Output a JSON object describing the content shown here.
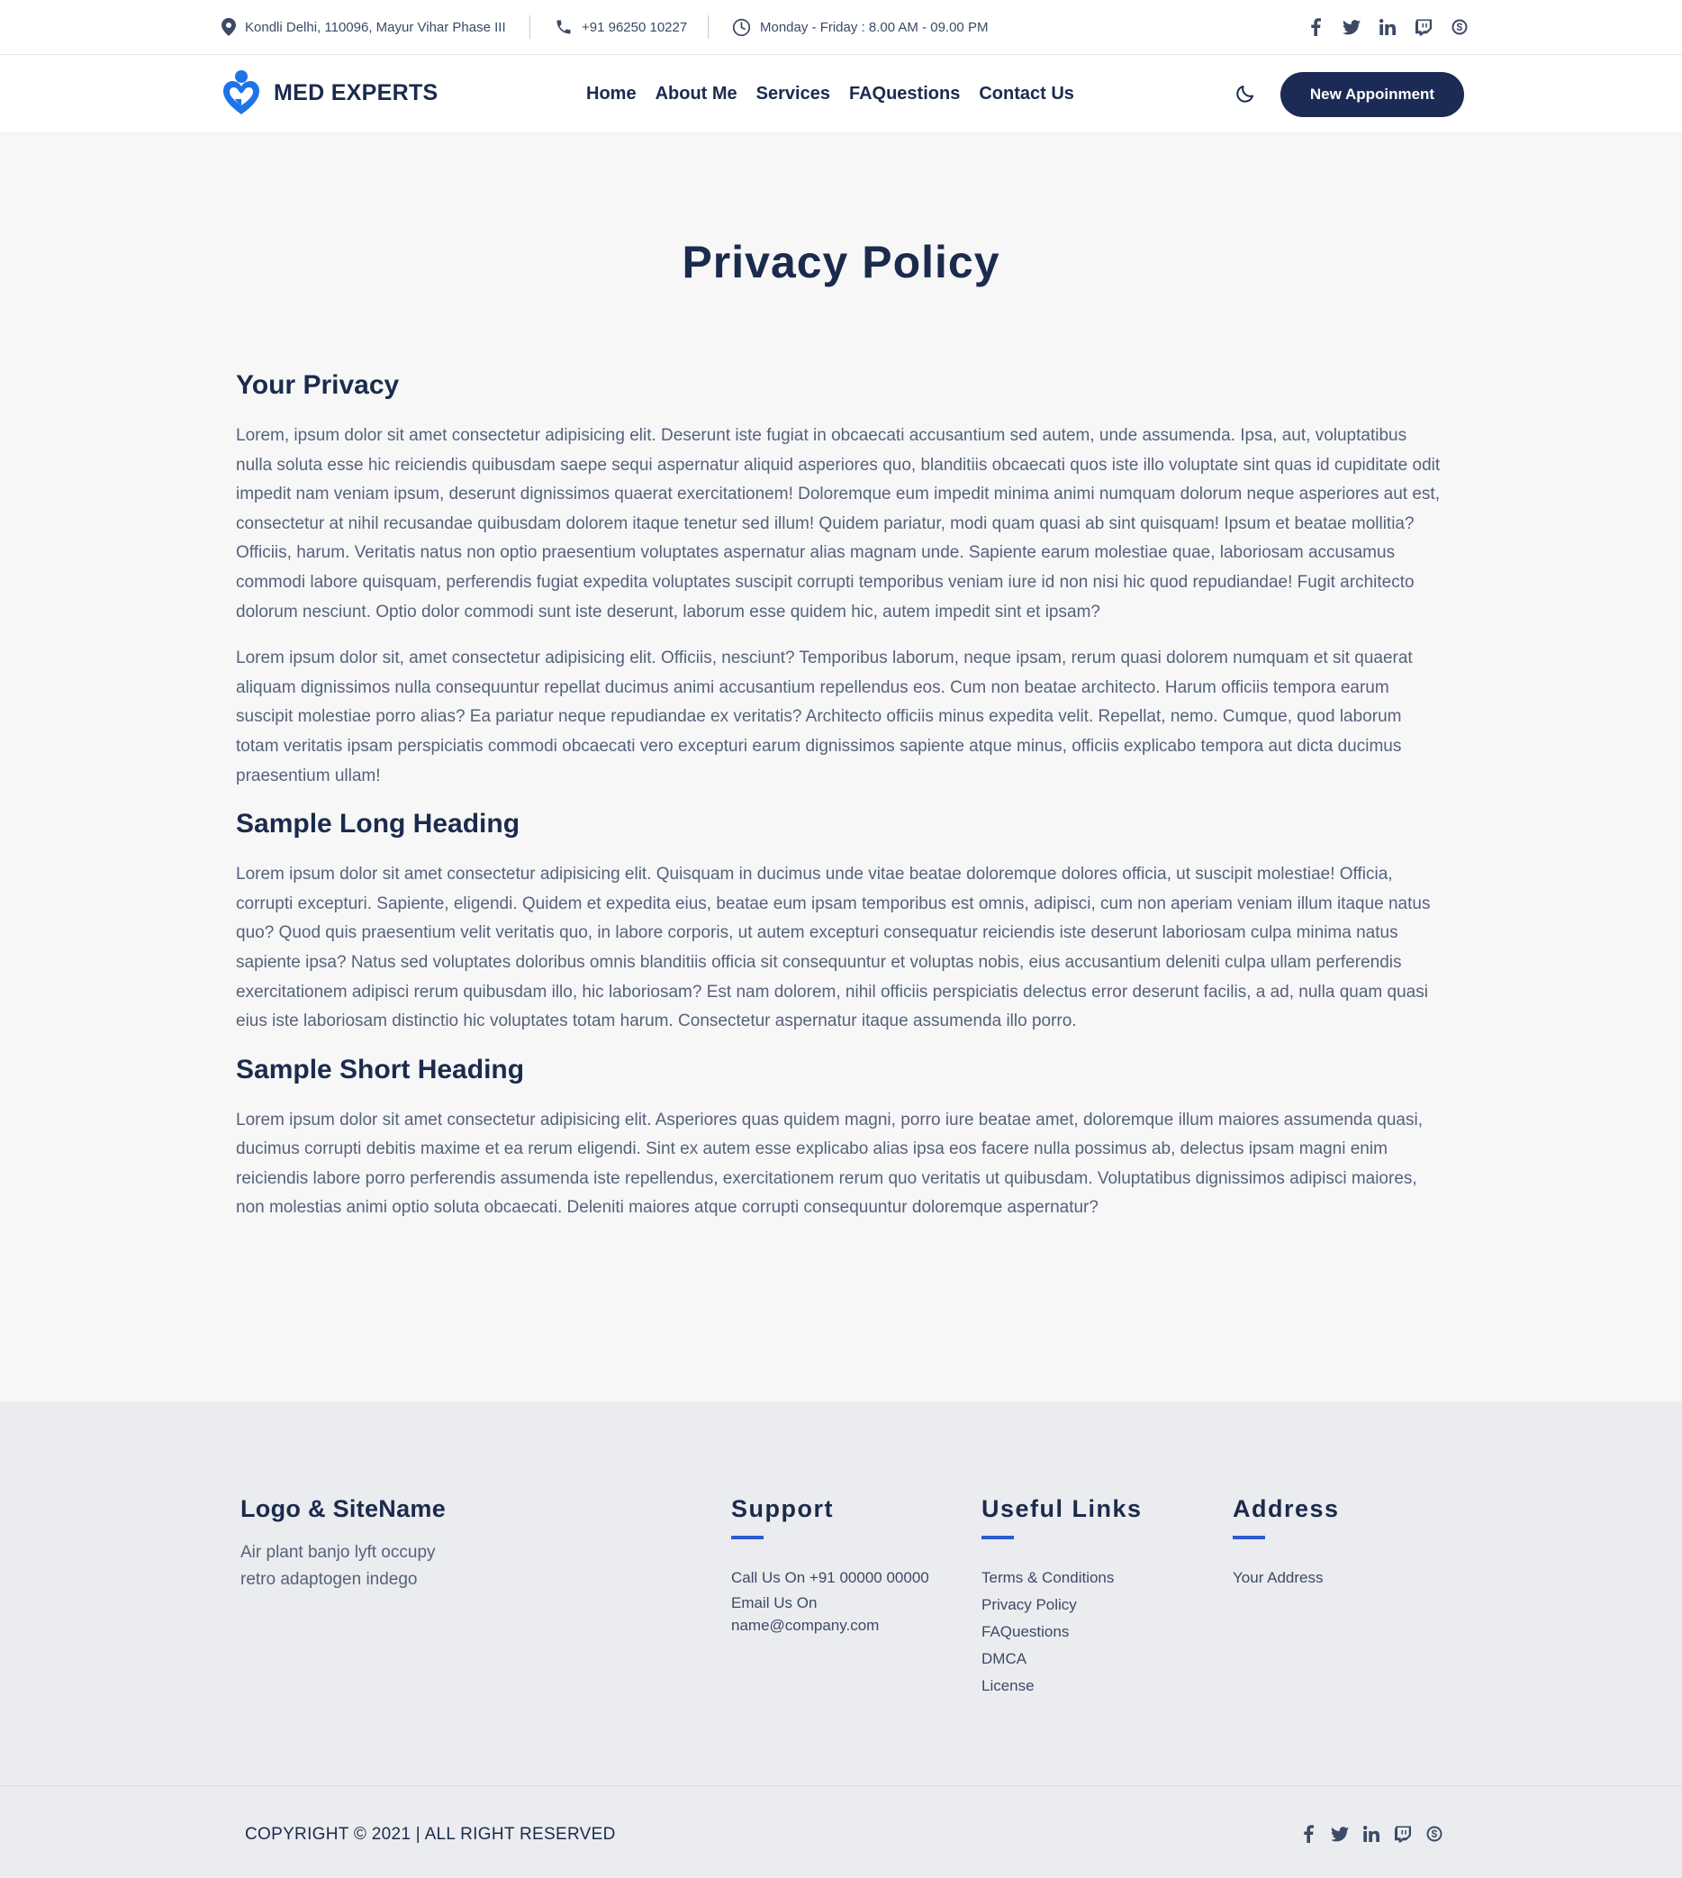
{
  "topbar": {
    "address": "Kondli Delhi, 110096, Mayur Vihar Phase III",
    "phone": "+91 96250 10227",
    "hours": "Monday - Friday : 8.00 AM - 09.00 PM",
    "socials": [
      "facebook-icon",
      "twitter-icon",
      "linkedin-icon",
      "twitch-icon",
      "skype-icon"
    ]
  },
  "nav": {
    "brand": "MED EXPERTS",
    "links": [
      "Home",
      "About Me",
      "Services",
      "FAQuestions",
      "Contact Us"
    ],
    "cta": "New Appoinment"
  },
  "colors": {
    "primary": "#1b2b55",
    "accent": "#2d5bd0",
    "logo": "#1f73e8"
  },
  "main": {
    "title": "Privacy Policy",
    "sections": [
      {
        "heading": "Your Privacy",
        "paragraphs": [
          "Lorem, ipsum dolor sit amet consectetur adipisicing elit. Deserunt iste fugiat in obcaecati accusantium sed autem, unde assumenda. Ipsa, aut, voluptatibus nulla soluta esse hic reiciendis quibusdam saepe sequi aspernatur aliquid asperiores quo, blanditiis obcaecati quos iste illo voluptate sint quas id cupiditate odit impedit nam veniam ipsum, deserunt dignissimos quaerat exercitationem! Doloremque eum impedit minima animi numquam dolorum neque asperiores aut est, consectetur at nihil recusandae quibusdam dolorem itaque tenetur sed illum! Quidem pariatur, modi quam quasi ab sint quisquam! Ipsum et beatae mollitia? Officiis, harum. Veritatis natus non optio praesentium voluptates aspernatur alias magnam unde. Sapiente earum molestiae quae, laboriosam accusamus commodi labore quisquam, perferendis fugiat expedita voluptates suscipit corrupti temporibus veniam iure id non nisi hic quod repudiandae! Fugit architecto dolorum nesciunt. Optio dolor commodi sunt iste deserunt, laborum esse quidem hic, autem impedit sint et ipsam?",
          "Lorem ipsum dolor sit, amet consectetur adipisicing elit. Officiis, nesciunt? Temporibus laborum, neque ipsam, rerum quasi dolorem numquam et sit quaerat aliquam dignissimos nulla consequuntur repellat ducimus animi accusantium repellendus eos. Cum non beatae architecto. Harum officiis tempora earum suscipit molestiae porro alias? Ea pariatur neque repudiandae ex veritatis? Architecto officiis minus expedita velit. Repellat, nemo. Cumque, quod laborum totam veritatis ipsam perspiciatis commodi obcaecati vero excepturi earum dignissimos sapiente atque minus, officiis explicabo tempora aut dicta ducimus praesentium ullam!"
        ]
      },
      {
        "heading": "Sample Long Heading",
        "paragraphs": [
          "Lorem ipsum dolor sit amet consectetur adipisicing elit. Quisquam in ducimus unde vitae beatae doloremque dolores officia, ut suscipit molestiae! Officia, corrupti excepturi. Sapiente, eligendi. Quidem et expedita eius, beatae eum ipsam temporibus est omnis, adipisci, cum non aperiam veniam illum itaque natus quo? Quod quis praesentium velit veritatis quo, in labore corporis, ut autem excepturi consequatur reiciendis iste deserunt laboriosam culpa minima natus sapiente ipsa? Natus sed voluptates doloribus omnis blanditiis officia sit consequuntur et voluptas nobis, eius accusantium deleniti culpa ullam perferendis exercitationem adipisci rerum quibusdam illo, hic laboriosam? Est nam dolorem, nihil officiis perspiciatis delectus error deserunt facilis, a ad, nulla quam quasi eius iste laboriosam distinctio hic voluptates totam harum. Consectetur aspernatur itaque assumenda illo porro."
        ]
      },
      {
        "heading": "Sample Short Heading",
        "paragraphs": [
          "Lorem ipsum dolor sit amet consectetur adipisicing elit. Asperiores quas quidem magni, porro iure beatae amet, doloremque illum maiores assumenda quasi, ducimus corrupti debitis maxime et ea rerum eligendi. Sint ex autem esse explicabo alias ipsa eos facere nulla possimus ab, delectus ipsam magni enim reiciendis labore porro perferendis assumenda iste repellendus, exercitationem rerum quo veritatis ut quibusdam. Voluptatibus dignissimos adipisci maiores, non molestias animi optio soluta obcaecati. Deleniti maiores atque corrupti consequuntur doloremque aspernatur?"
        ]
      }
    ]
  },
  "footer": {
    "brand_heading": "Logo & SiteName",
    "tagline": "Air plant banjo lyft occupy retro adaptogen indego",
    "support": {
      "heading": "Support",
      "call": "Call Us On +91 00000 00000",
      "email_label": "Email Us On",
      "email": "name@company.com"
    },
    "useful_links": {
      "heading": "Useful Links",
      "items": [
        "Terms & Conditions",
        "Privacy Policy",
        "FAQuestions",
        "DMCA",
        "License"
      ]
    },
    "address": {
      "heading": "Address",
      "value": "Your Address"
    },
    "copyright": "COPYRIGHT © 2021 | ALL RIGHT RESERVED"
  }
}
